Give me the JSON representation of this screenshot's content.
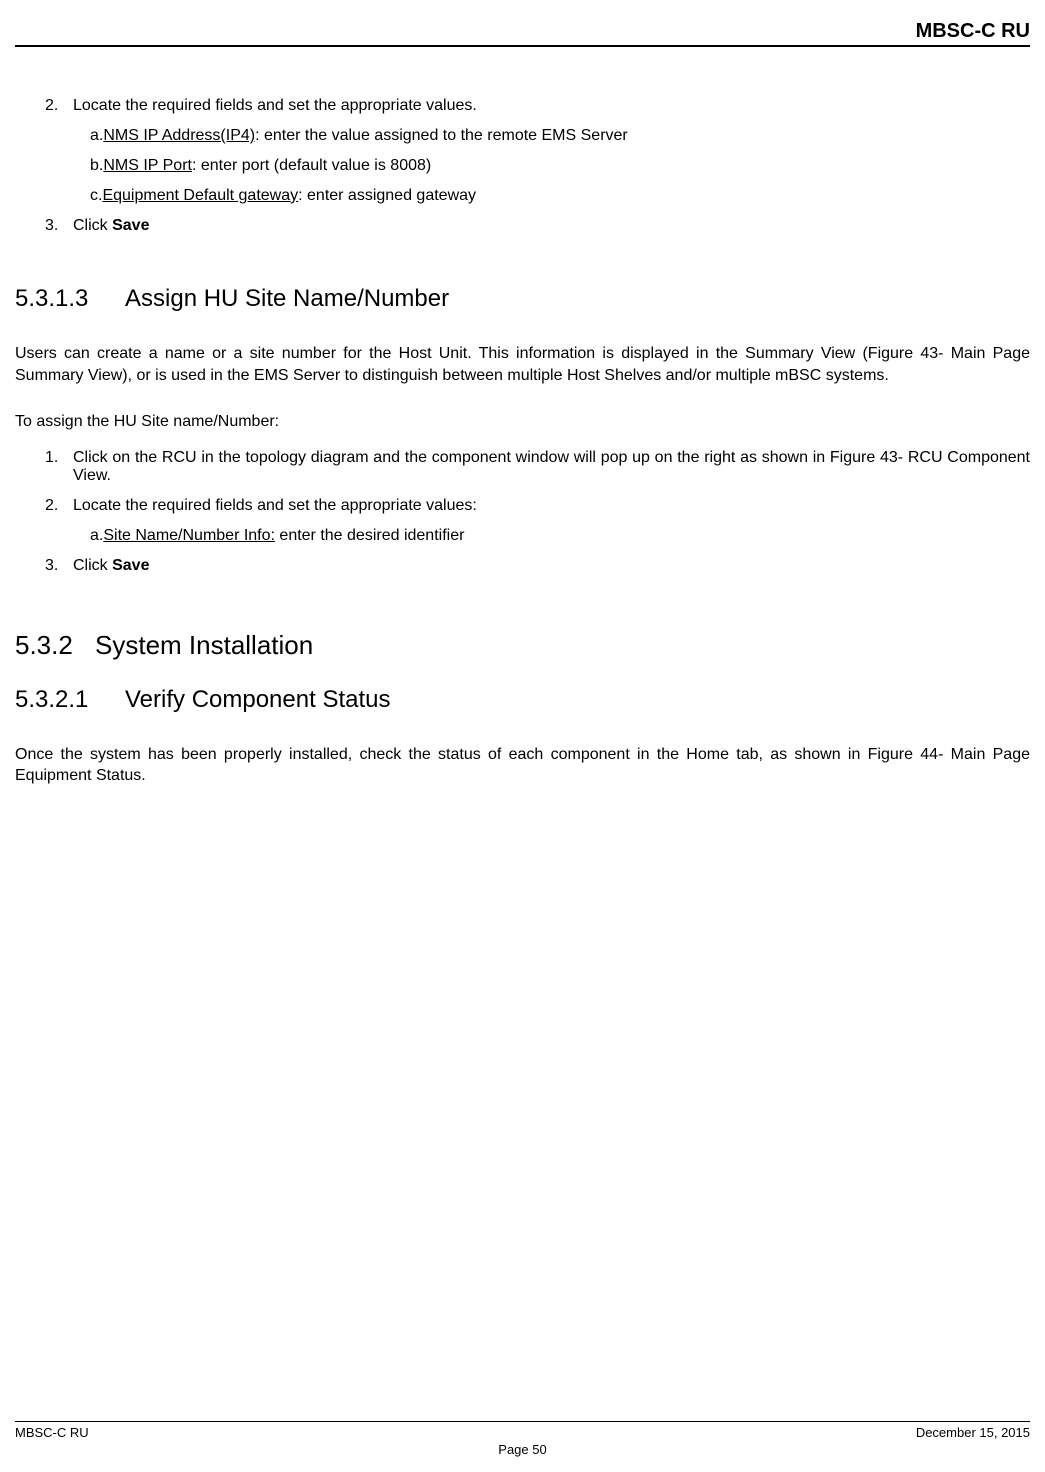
{
  "header": {
    "title": "MBSC-C RU"
  },
  "section1": {
    "step2": {
      "num": "2.",
      "text": "Locate the required fields and set the appropriate values."
    },
    "sub_a": {
      "prefix": "a.",
      "label": "NMS IP Address(IP4)",
      "text": ": enter the value assigned to the remote EMS Server"
    },
    "sub_b": {
      "prefix": "b.",
      "label": "NMS IP Port",
      "text": ": enter port (default value is 8008)"
    },
    "sub_c": {
      "prefix": "c.",
      "label": "Equipment Default gateway",
      "text": ": enter assigned gateway"
    },
    "step3": {
      "num": "3.",
      "text_prefix": "Click ",
      "text_bold": "Save"
    }
  },
  "section5313": {
    "num": "5.3.1.3",
    "title": "Assign HU Site Name/Number",
    "para1": "Users can create a name or a site number for the Host Unit. This information is displayed in the Summary View (Figure 43- Main Page Summary View), or is used in the EMS Server to distinguish between multiple Host Shelves and/or multiple mBSC systems.",
    "intro": "To assign the HU Site name/Number:",
    "step1": {
      "num": "1.",
      "text": "Click on the RCU in the topology diagram and the component window will pop up on the right as shown in Figure 43- RCU Component View."
    },
    "step2": {
      "num": "2.",
      "text": "Locate the required fields and set the appropriate values:"
    },
    "sub_a": {
      "prefix": "a.",
      "label": "Site Name/Number Info:",
      "text": " enter the desired identifier"
    },
    "step3": {
      "num": "3.",
      "text_prefix": "Click ",
      "text_bold": "Save"
    }
  },
  "section532": {
    "num": "5.3.2",
    "title": "System Installation"
  },
  "section5321": {
    "num": "5.3.2.1",
    "title": "Verify Component Status",
    "para1": "Once the system has been properly installed, check the status of each component in the Home tab, as shown in Figure 44- Main Page Equipment Status."
  },
  "footer": {
    "left": "MBSC-C RU",
    "right": "December 15, 2015",
    "center": "Page 50"
  }
}
